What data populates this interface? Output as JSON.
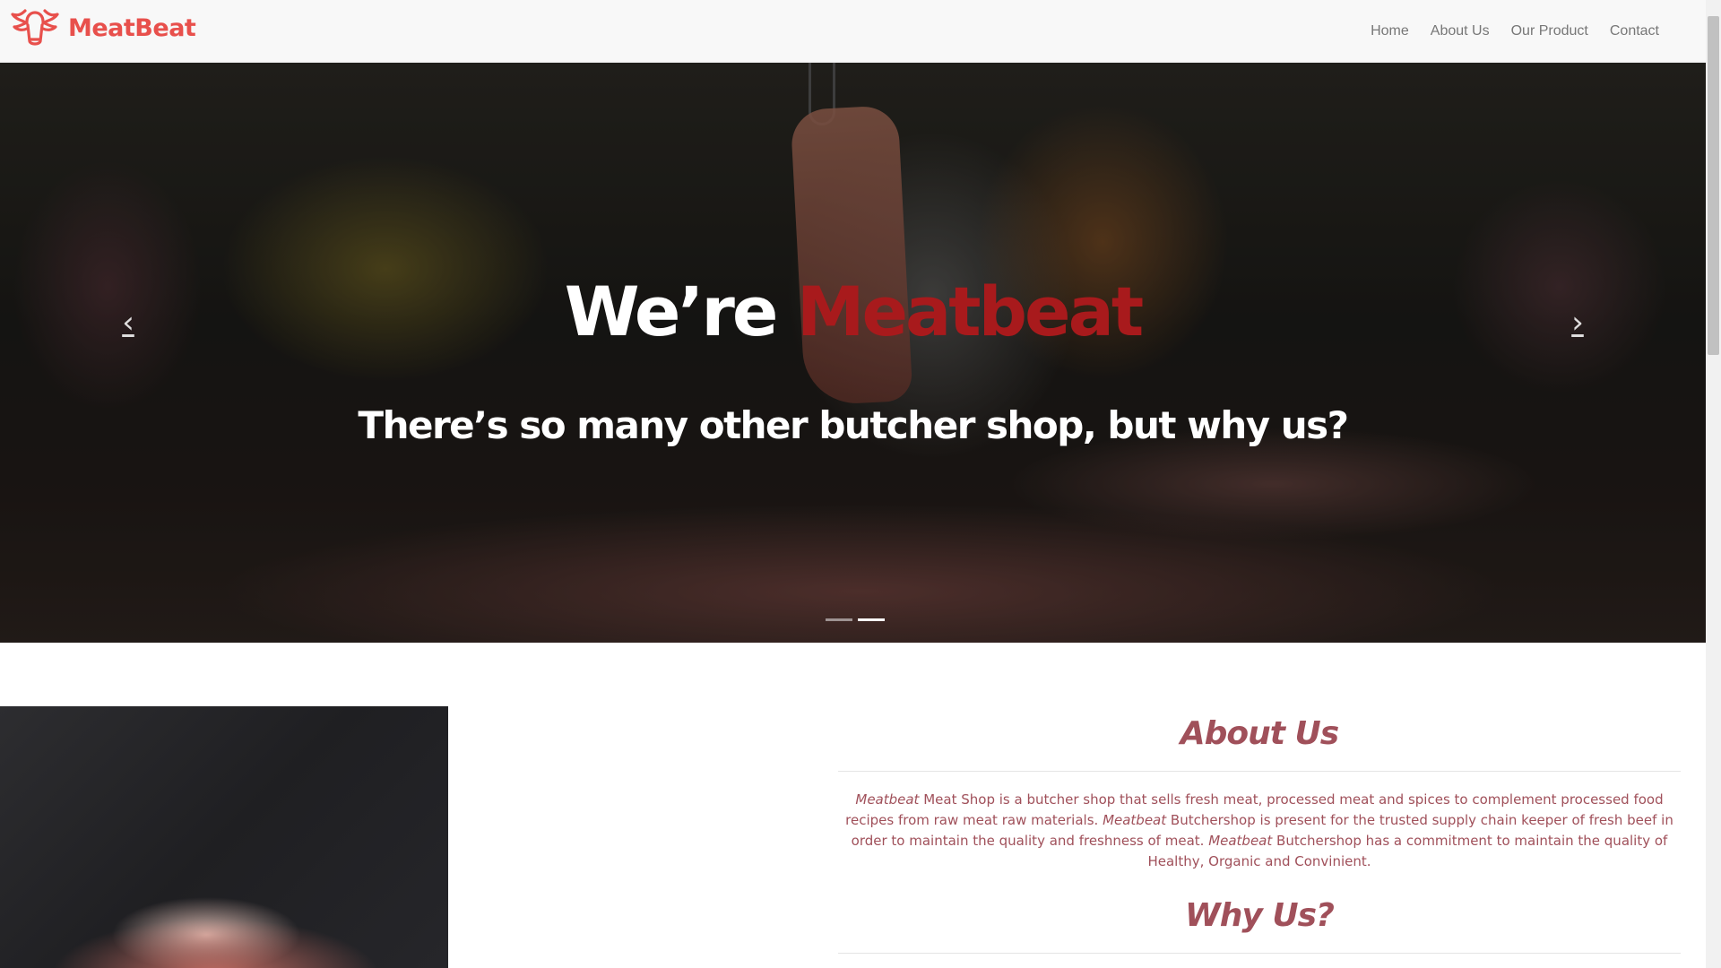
{
  "brand": {
    "name": "MeatBeat",
    "color": "#e8504c",
    "logo_icon": "bull-head-icon"
  },
  "nav": {
    "items": [
      {
        "label": "Home"
      },
      {
        "label": "About Us"
      },
      {
        "label": "Our Product"
      },
      {
        "label": "Contact"
      }
    ]
  },
  "hero": {
    "title_prefix": "We’re ",
    "title_accent": "Meatbeat",
    "subtitle": "There’s so many other butcher shop, but why us?",
    "accent_color": "#a81a1c",
    "prev_icon": "chevron-left-icon",
    "next_icon": "chevron-right-icon",
    "slides_count": 2,
    "active_slide": 2
  },
  "about": {
    "title": "About Us",
    "paragraph": [
      {
        "brand": "Meatbeat",
        "text": " Meat Shop is a butcher shop that sells fresh meat, processed meat and spices to complement processed food recipes from raw meat raw materials. "
      },
      {
        "brand": "Meatbeat",
        "text": " Butchershop is present for the trusted supply chain keeper of fresh beef in order to maintain the quality and freshness of meat. "
      },
      {
        "brand": "Meatbeat",
        "text": " Butchershop has a commitment to maintain the quality of Healthy, Organic and Convinient."
      }
    ],
    "text_color": "#a0505a"
  },
  "why": {
    "title": "Why Us?"
  }
}
